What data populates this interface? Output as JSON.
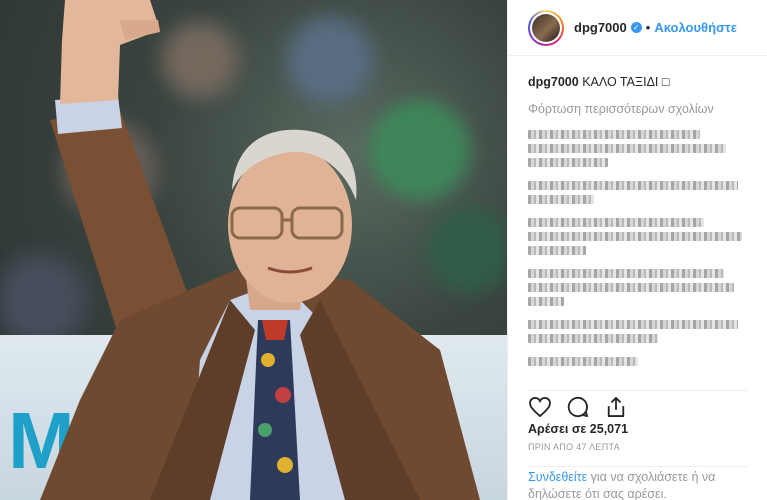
{
  "header": {
    "username": "dpg7000",
    "follow_label": "Ακολουθήστε",
    "separator": "•",
    "verified_icon": "verified-check-icon"
  },
  "post": {
    "caption_user": "dpg7000",
    "caption_text": "ΚΑΛΟ ΤΑΞΙΔΙ",
    "caption_emoji": "□",
    "load_more_label": "Φόρτωση περισσότερων σχολίων"
  },
  "comments_blurred": [
    {
      "lines": 3
    },
    {
      "lines": 2
    },
    {
      "lines": 3
    },
    {
      "lines": 3
    },
    {
      "lines": 3
    },
    {
      "lines": 1
    }
  ],
  "actions": {
    "like_icon": "heart-icon",
    "comment_icon": "comment-bubble-icon",
    "share_icon": "share-icon"
  },
  "likes_text": "Αρέσει σε 25,071",
  "timestamp_text": "ΠΡΙΝ ΑΠΟ 47 ΛΕΠΤΑ",
  "login_prompt": {
    "link_text": "Συνδεθείτε",
    "rest_text": " για να σχολιάσετε ή να δηλώσετε ότι σας αρέσει."
  },
  "colors": {
    "accent_blue": "#3897f0",
    "text": "#262626",
    "muted": "#999999"
  }
}
